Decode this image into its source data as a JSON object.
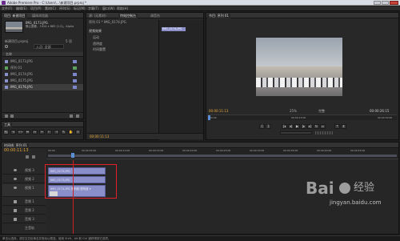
{
  "titlebar": {
    "title": "Adobe Premiere Pro - C:\\Users\\...\\新建项目.prproj *"
  },
  "menu": [
    "文件(F)",
    "编辑(E)",
    "项目(P)",
    "素材(C)",
    "序列(S)",
    "标记(M)",
    "字幕(T)",
    "窗口(W)",
    "帮助(H)"
  ],
  "project": {
    "tabs": [
      "项目: 新建项目",
      "媒体浏览器"
    ],
    "clip_name": "IMG_0173.JPG",
    "clip_info": [
      "静止图像，1024 x 683 (1.0)，Alpha",
      ""
    ],
    "project_file": "新建项目.prproj",
    "item_count": "5 项",
    "search_placeholder": "入点: 全部",
    "column_header": "名称",
    "items": [
      {
        "name": "IMG_0173.JPG",
        "color": "#7d86c9"
      },
      {
        "name": "序列 01",
        "color": "#5fa05f"
      },
      {
        "name": "IMG_0174.JPG",
        "color": "#7d86c9"
      },
      {
        "name": "IMG_0175.JPG",
        "color": "#7d86c9"
      },
      {
        "name": "IMG_0176.JPG",
        "color": "#7d86c9"
      }
    ]
  },
  "effects": {
    "tabs": [
      "源: (无素材)",
      "特效控制台",
      "调音台"
    ],
    "sequence_label": "序列 01 * IMG_0174.JPG",
    "clip_tag": "IMG_0174.JPG",
    "items": [
      "视频效果",
      "运动",
      "透明度",
      "时间重置"
    ],
    "timecode": "00:00:11:13"
  },
  "program": {
    "tab": "节目: 序列 01",
    "timecode_left": "00:00:11:13",
    "timecode_right": "00:00:26:15",
    "zoom": "25%",
    "quality": "完整",
    "ruler_left": "00:00",
    "ruler_mid": "00:00:15:00",
    "ruler_right": "00:00:30:00"
  },
  "tools": {
    "tab": "工具"
  },
  "timeline": {
    "tab": "时间线: 序列 01",
    "timecode": "00:00:11:13",
    "ruler": [
      "00:00",
      "00:00:05:00",
      "00:00:10:00",
      "00:00:15:00",
      "00:00:20:00",
      "00:00:25:00",
      "00:00:30:00",
      "00:00:35:00",
      "00:00:40:00",
      "00:00:45:00"
    ],
    "tracks": [
      {
        "name": "视频 3",
        "type": "video"
      },
      {
        "name": "视频 2",
        "type": "video"
      },
      {
        "name": "视频 1",
        "type": "video"
      },
      {
        "name": "音频 1",
        "type": "audio"
      },
      {
        "name": "音频 2",
        "type": "audio"
      },
      {
        "name": "音频 3",
        "type": "audio"
      },
      {
        "name": "主音轨",
        "type": "master"
      }
    ],
    "clips": [
      "IMG_0175.JPG",
      "IMG_0173.JPG",
      "IMG_0174.JPG 透明度:透明度 ▾"
    ]
  },
  "status": {
    "text": "单击以选择，或在空白处单击并拖动以框选。使用 Shift、Alt 和 Ctrl 键获得其它选项。"
  },
  "watermark": {
    "brand": "Bai",
    "brand2": "经验",
    "url": "jingyan.baidu.com"
  },
  "colors": {
    "clip": "#8a8fc9",
    "playhead": "#c22",
    "highlight": "#e0202a",
    "timecode": "#e8a83a"
  }
}
